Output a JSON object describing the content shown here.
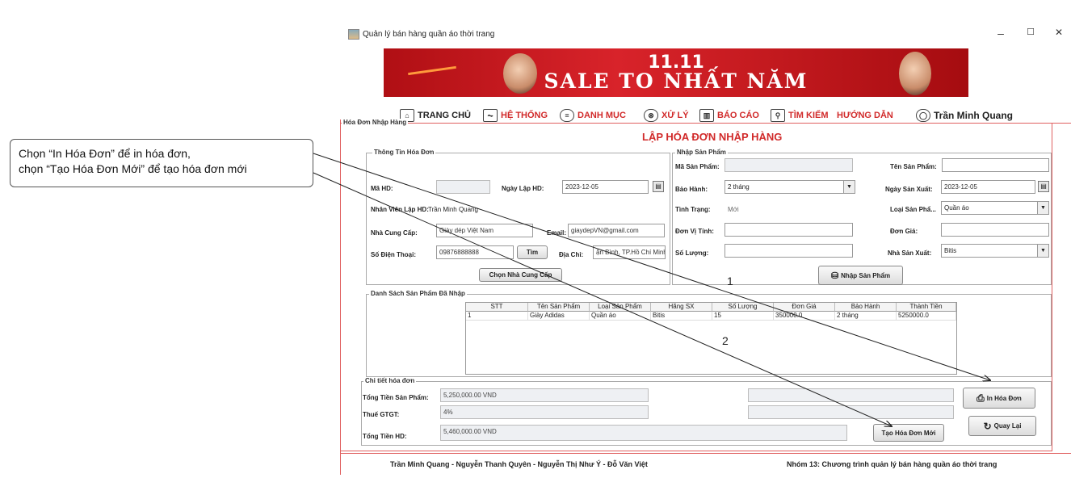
{
  "callout": {
    "line1": "Chọn “In Hóa Đơn” để in hóa đơn,",
    "line2": "chọn “Tạo Hóa Đơn Mới” để tạo hóa đơn mới"
  },
  "window": {
    "title": "Quản lý bán hàng quần áo thời trang",
    "minimize": "–",
    "maximize": "☐",
    "close": "✕"
  },
  "banner": {
    "line1": "11.11",
    "line2": "SALE TO NHẤT NĂM"
  },
  "menu": {
    "home": "TRANG CHỦ",
    "system": "HỆ THỐNG",
    "catalog": "DANH MỤC",
    "process": "XỬ LÝ",
    "report": "BÁO CÁO",
    "search": "TÌM KIẾM",
    "guide": "HƯỚNG DẪN",
    "user": "Trần Minh Quang"
  },
  "panel": {
    "legend": "Hóa Đơn Nhập Hàng",
    "heading": "LẬP HÓA ĐƠN NHẬP HÀNG"
  },
  "invoice_info": {
    "legend": "Thông Tin Hóa Đơn",
    "ma_hd_label": "Mã HD:",
    "ma_hd": "",
    "ngay_lap_label": "Ngày Lập HD:",
    "ngay_lap": "2023-12-05",
    "nhan_vien_label": "Nhân Viên Lập HD:",
    "nhan_vien": "Trần Minh Quang",
    "ncc_label": "Nhà Cung Cấp:",
    "ncc": "Giày dép Việt Nam",
    "email_label": "Email:",
    "email": "giaydepVN@gmail.com",
    "sdt_label": "Số Điện Thoại:",
    "sdt": "09876888888",
    "tim_button": "Tìm",
    "dia_chi_label": "Địa Chỉ:",
    "dia_chi": "ận Bình, TP.Hồ Chí Minh",
    "chon_ncc_button": "Chọn Nhà Cung Cấp"
  },
  "product_input": {
    "legend": "Nhập Sản Phẩm",
    "ma_sp_label": "Mã Sản Phẩm:",
    "ma_sp": "",
    "ten_sp_label": "Tên Sản Phẩm:",
    "ten_sp": "",
    "bao_hanh_label": "Bảo Hành:",
    "bao_hanh": "2 tháng",
    "ngay_sx_label": "Ngày Sản Xuất:",
    "ngay_sx": "2023-12-05",
    "tinh_trang_label": "Tình Trạng:",
    "tinh_trang": "Mới",
    "loai_sp_label": "Loại Sản Phẩ...",
    "loai_sp": "Quần áo",
    "don_vi_label": "Đơn Vị Tính:",
    "don_vi": "",
    "don_gia_label": "Đơn Giá:",
    "don_gia": "",
    "so_luong_label": "Số Lượng:",
    "so_luong": "",
    "nha_sx_label": "Nhà Sản Xuất:",
    "nha_sx": "Bitis",
    "nhap_button": "Nhập Sản Phẩm"
  },
  "product_list": {
    "legend": "Danh Sách Sản Phẩm Đã Nhập",
    "columns": [
      "STT",
      "Tên Sản Phẩm",
      "Loại Sản Phẩm",
      "Hãng SX",
      "Số Lượng",
      "Đơn Giá",
      "Bảo Hành",
      "Thành Tiền"
    ],
    "rows": [
      [
        "1",
        "Giày Adidas",
        "Quần áo",
        "Bitis",
        "15",
        "350000.0",
        "2 tháng",
        "5250000.0"
      ]
    ]
  },
  "details": {
    "legend": "Chi tiết hóa đơn",
    "tong_sp_label": "Tổng Tiền Sản Phẩm:",
    "tong_sp": "5,250,000.00 VND",
    "vat_label": "Thuế GTGT:",
    "vat": "4%",
    "tong_hd_label": "Tổng Tiền HD:",
    "tong_hd": "5,460,000.00 VND",
    "tao_moi_button": "Tạo Hóa Đơn Mới",
    "in_button": "In Hóa Đơn",
    "quay_lai_button": "Quay Lại"
  },
  "annotations": {
    "n1": "1",
    "n2": "2"
  },
  "footer": {
    "authors": "Trần Minh Quang - Nguyễn Thanh Quyên - Nguyễn Thị Như Ý - Đỗ Văn Việt",
    "group": "Nhóm 13: Chương trình quản lý bán hàng quần áo thời trang"
  },
  "colors": {
    "accent_red": "#d12a2a",
    "banner_red": "#c0181d"
  }
}
